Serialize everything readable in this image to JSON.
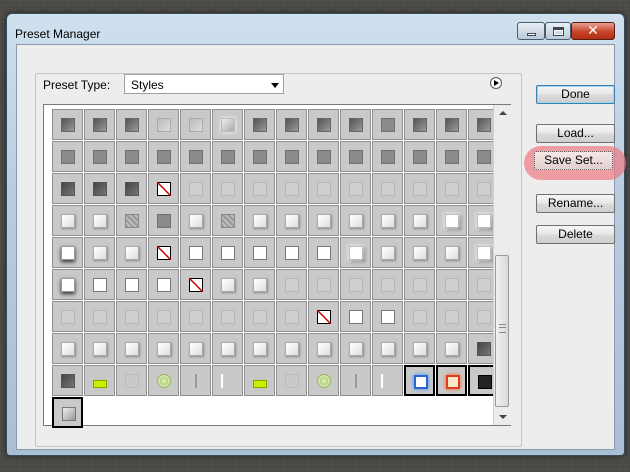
{
  "window": {
    "title": "Preset Manager"
  },
  "preset_type": {
    "label": "Preset Type:",
    "value": "Styles"
  },
  "buttons": {
    "done": "Done",
    "load": "Load...",
    "save_set": "Save Set...",
    "rename": "Rename...",
    "delete": "Delete"
  },
  "icons": {
    "minimize": "minimize-icon",
    "maximize": "maximize-icon",
    "close": "close-icon",
    "panel_menu": "panel-menu-arrow-icon",
    "dropdown": "chevron-down-icon"
  },
  "highlight_color": "#f07882",
  "style_presets": [
    [
      "gray-inset",
      "gray-inset",
      "gray-inset",
      "gray-soft",
      "gray-soft",
      "gray-glow",
      "gray-inset",
      "gray-inset",
      "gray-inset",
      "gray-inset",
      "gray-flat",
      "gray-inset",
      "gray-inset",
      "gray-inset"
    ],
    [
      "gray-flat",
      "gray-flat",
      "gray-flat",
      "gray-flat",
      "gray-flat",
      "gray-flat",
      "gray-flat",
      "gray-flat",
      "gray-flat",
      "gray-flat",
      "gray-flat",
      "gray-flat",
      "gray-flat",
      "gray-flat"
    ],
    [
      "gray-dark",
      "gray-dark",
      "gray-dark",
      "none",
      "gray-light",
      "gray-light",
      "gray-light",
      "gray-light",
      "gray-light",
      "gray-light",
      "gray-light",
      "gray-light",
      "gray-light",
      "gray-light"
    ],
    [
      "white-bevel",
      "white-bevel",
      "texture",
      "gray-flat",
      "white-bevel",
      "texture",
      "white-bevel",
      "white-bevel",
      "white-bevel",
      "white-bevel",
      "white-bevel",
      "white-bevel",
      "white-glow",
      "white-glow"
    ],
    [
      "white-shadow",
      "white-bevel",
      "white-bevel",
      "none",
      "white-box",
      "white-box",
      "white-box",
      "white-box",
      "white-box",
      "white-glow",
      "white-bevel",
      "white-bevel",
      "white-bevel",
      "white-glow"
    ],
    [
      "white-shadow",
      "white-box",
      "white-box",
      "white-box",
      "none",
      "white-bevel",
      "white-bevel",
      "gray-light",
      "gray-light",
      "gray-light",
      "gray-light",
      "gray-light",
      "gray-light",
      "gray-light"
    ],
    [
      "gray-light",
      "gray-light",
      "gray-light",
      "gray-light",
      "gray-light",
      "gray-light",
      "gray-light",
      "gray-light",
      "none",
      "white-box",
      "white-box",
      "gray-light",
      "gray-light",
      "gray-light"
    ],
    [
      "white-bevel",
      "white-bevel",
      "white-bevel",
      "white-bevel",
      "white-bevel",
      "white-bevel",
      "white-bevel",
      "white-bevel",
      "white-bevel",
      "white-bevel",
      "white-bevel",
      "white-bevel",
      "white-bevel",
      "gray-dark"
    ],
    [
      "gray-dark",
      "lime",
      "outline",
      "swirl",
      "line",
      "flag",
      "lime",
      "outline",
      "swirl",
      "line",
      "flag",
      "blue-glow",
      "red-glow",
      "black"
    ],
    [
      "silver"
    ]
  ]
}
